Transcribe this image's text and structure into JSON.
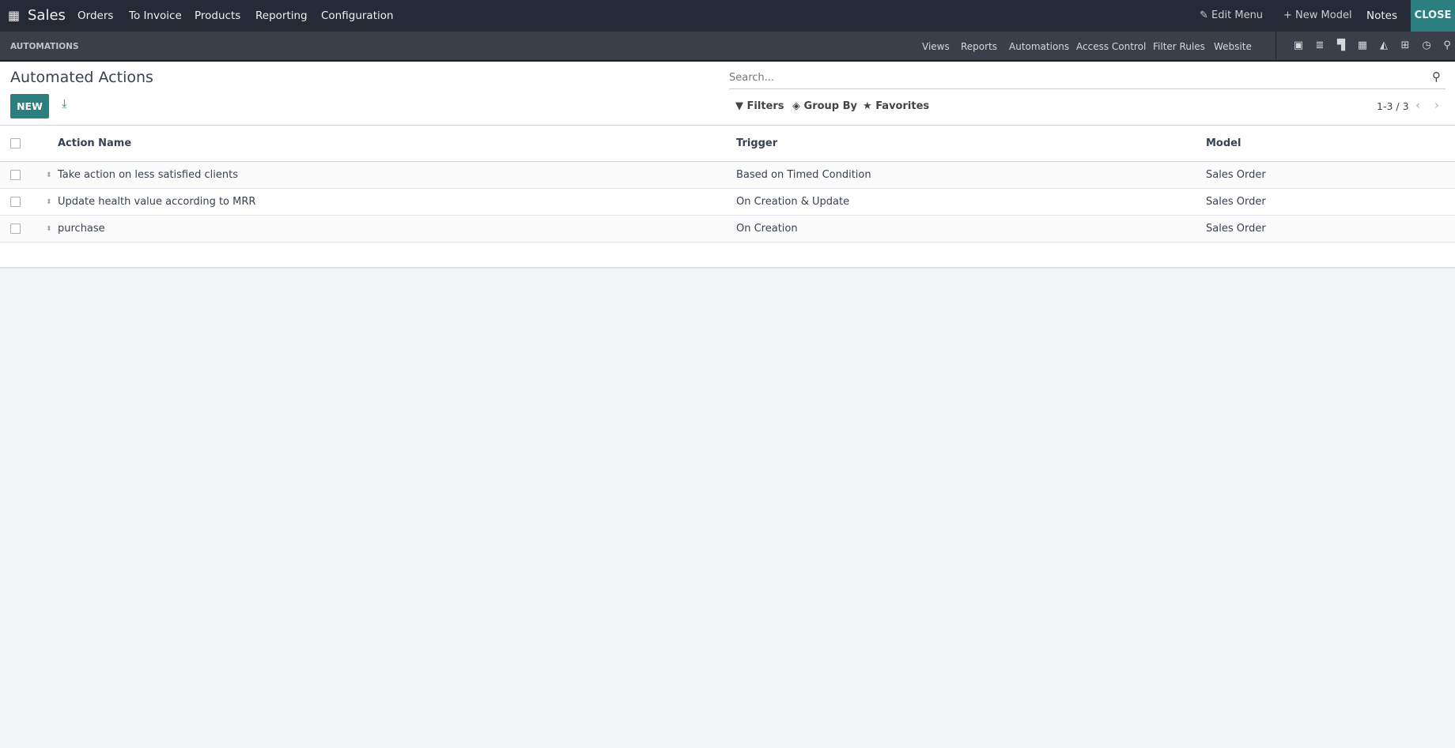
{
  "navbar": {
    "app": "Sales",
    "menu": [
      "Orders",
      "To Invoice",
      "Products",
      "Reporting",
      "Configuration"
    ],
    "edit_menu": "Edit Menu",
    "new_model": "New Model",
    "notes": "Notes",
    "close": "CLOSE"
  },
  "studio": {
    "title": "AUTOMATIONS",
    "tabs": [
      "Views",
      "Reports",
      "Automations",
      "Access Control",
      "Filter Rules",
      "Website"
    ]
  },
  "page": {
    "title": "Automated Actions",
    "new_label": "NEW",
    "search_placeholder": "Search...",
    "filters": "Filters",
    "group_by": "Group By",
    "favorites": "Favorites",
    "pager": "1-3 / 3"
  },
  "table": {
    "headers": [
      "Action Name",
      "Trigger",
      "Model"
    ],
    "rows": [
      {
        "name": "Take action on less satisfied clients",
        "trigger": "Based on Timed Condition",
        "model": "Sales Order"
      },
      {
        "name": "Update health value according to MRR",
        "trigger": "On Creation & Update",
        "model": "Sales Order"
      },
      {
        "name": "purchase",
        "trigger": "On Creation",
        "model": "Sales Order"
      }
    ]
  },
  "colors": {
    "navbar": "#262a36",
    "subbar": "#3b3f4a",
    "accent": "#2b7f7f"
  }
}
